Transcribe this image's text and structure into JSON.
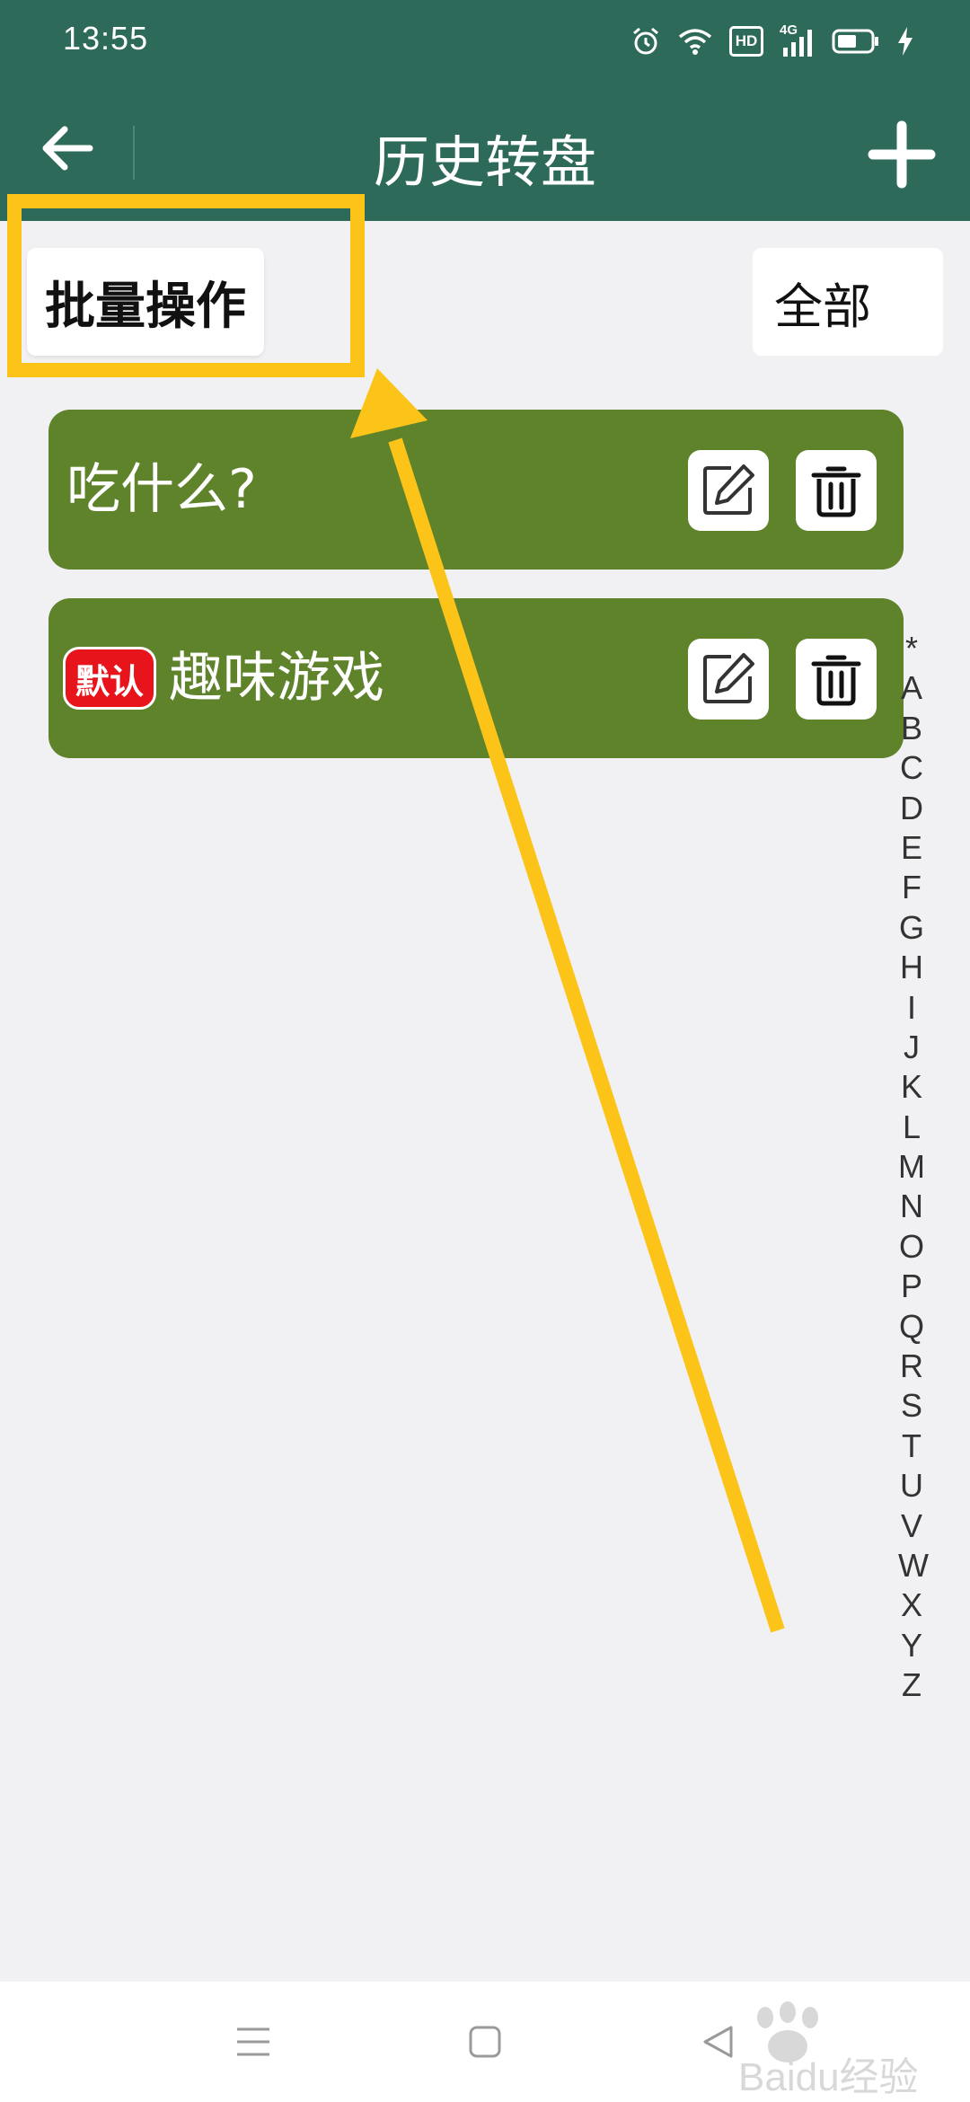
{
  "status_bar": {
    "time": "13:55",
    "icons": [
      "alarm-icon",
      "wifi-icon",
      "hd-icon",
      "signal-4g-icon",
      "battery-icon",
      "charging-icon"
    ],
    "hd_label": "HD",
    "network_label": "4G"
  },
  "header": {
    "title": "历史转盘",
    "back_icon": "back-arrow-icon",
    "add_icon": "plus-icon"
  },
  "toolbar": {
    "batch_label": "批量操作",
    "filter_value": "全部"
  },
  "wheels": [
    {
      "name": "吃什么?",
      "is_default": false
    },
    {
      "name": "趣味游戏",
      "is_default": true
    }
  ],
  "default_badge_label": "默认",
  "alphabet_index": [
    "*",
    "A",
    "B",
    "C",
    "D",
    "E",
    "F",
    "G",
    "H",
    "I",
    "J",
    "K",
    "L",
    "M",
    "N",
    "O",
    "P",
    "Q",
    "R",
    "S",
    "T",
    "U",
    "V",
    "W",
    "X",
    "Y",
    "Z"
  ],
  "navbar": {
    "icons": [
      "menu-icon",
      "home-icon",
      "back-triangle-icon"
    ]
  },
  "watermark": {
    "text": "Baidu经验"
  },
  "colors": {
    "header": "#2d6a5a",
    "card": "#5f832b",
    "background": "#f1f1f3",
    "badge": "#e8141b",
    "annotation": "#fcc418"
  }
}
